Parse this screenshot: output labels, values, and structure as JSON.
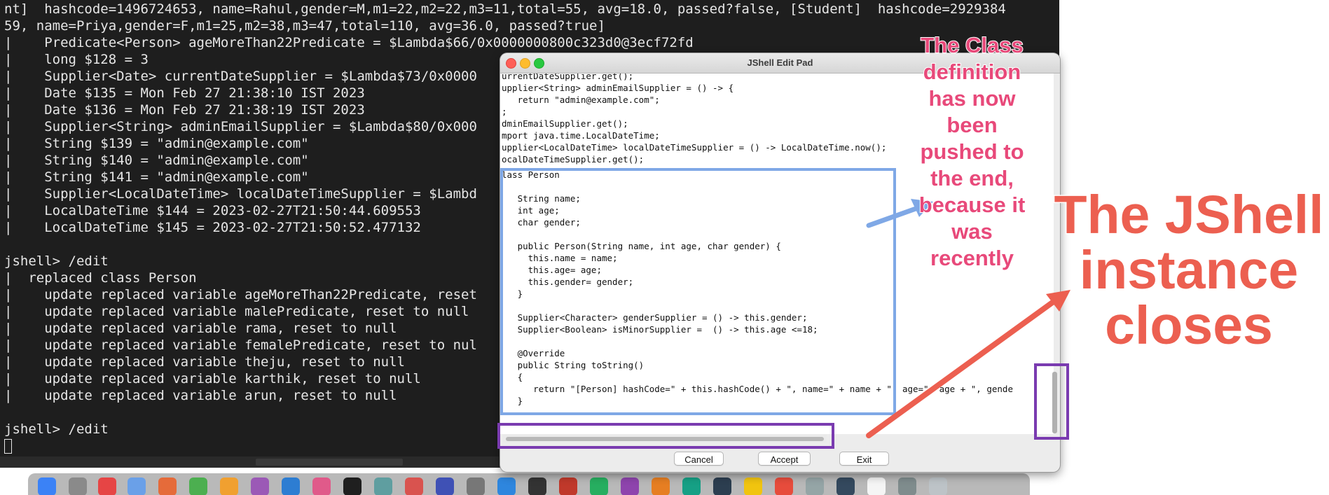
{
  "terminal": {
    "lines": [
      "nt]  hashcode=1496724653, name=Rahul,gender=M,m1=22,m2=22,m3=11,total=55, avg=18.0, passed?false, [Student]  hashcode=2929384",
      "59, name=Priya,gender=F,m1=25,m2=38,m3=47,total=110, avg=36.0, passed?true]",
      "|    Predicate<Person> ageMoreThan22Predicate = $Lambda$66/0x0000000800c323d0@3ecf72fd",
      "|    long $128 = 3",
      "|    Supplier<Date> currentDateSupplier = $Lambda$73/0x0000",
      "|    Date $135 = Mon Feb 27 21:38:10 IST 2023",
      "|    Date $136 = Mon Feb 27 21:38:19 IST 2023",
      "|    Supplier<String> adminEmailSupplier = $Lambda$80/0x000",
      "|    String $139 = \"admin@example.com\"",
      "|    String $140 = \"admin@example.com\"",
      "|    String $141 = \"admin@example.com\"",
      "|    Supplier<LocalDateTime> localDateTimeSupplier = $Lambd",
      "|    LocalDateTime $144 = 2023-02-27T21:50:44.609553",
      "|    LocalDateTime $145 = 2023-02-27T21:50:52.477132",
      "",
      "jshell> /edit",
      "|  replaced class Person",
      "|    update replaced variable ageMoreThan22Predicate, reset",
      "|    update replaced variable malePredicate, reset to null",
      "|    update replaced variable rama, reset to null",
      "|    update replaced variable femalePredicate, reset to nul",
      "|    update replaced variable theju, reset to null",
      "|    update replaced variable karthik, reset to null",
      "|    update replaced variable arun, reset to null",
      "",
      "jshell> /edit"
    ]
  },
  "editor": {
    "title": "JShell Edit Pad",
    "code_lines": [
      "urrentDateSupplier.get();",
      "upplier<String> adminEmailSupplier = () -> {",
      "   return \"admin@example.com\";",
      ";",
      "dminEmailSupplier.get();",
      "mport java.time.LocalDateTime;",
      "upplier<LocalDateTime> localDateTimeSupplier = () -> LocalDateTime.now();",
      "ocalDateTimeSupplier.get();",
      "lass Person",
      "",
      "   String name;",
      "   int age;",
      "   char gender;",
      "",
      "   public Person(String name, int age, char gender) {",
      "     this.name = name;",
      "     this.age= age;",
      "     this.gender= gender;",
      "   }",
      "",
      "   Supplier<Character> genderSupplier = () -> this.gender;",
      "   Supplier<Boolean> isMinorSupplier =  () -> this.age <=18;",
      "",
      "   @Override",
      "   public String toString()",
      "   {",
      "      return \"[Person] hashCode=\" + this.hashCode() + \", name=\" + name + \", age=\"+ age + \", gende",
      "   }"
    ],
    "buttons": {
      "cancel": "Cancel",
      "accept": "Accept",
      "exit": "Exit"
    }
  },
  "annotations": {
    "class_note": "The Class definition has now been pushed to the end, because it was recently",
    "closes_note": "The JShell instance closes",
    "colors": {
      "blue": "#7fa8e6",
      "purple": "#7a3bb0",
      "pink": "#e8497a",
      "coral": "#ec5f50"
    }
  }
}
